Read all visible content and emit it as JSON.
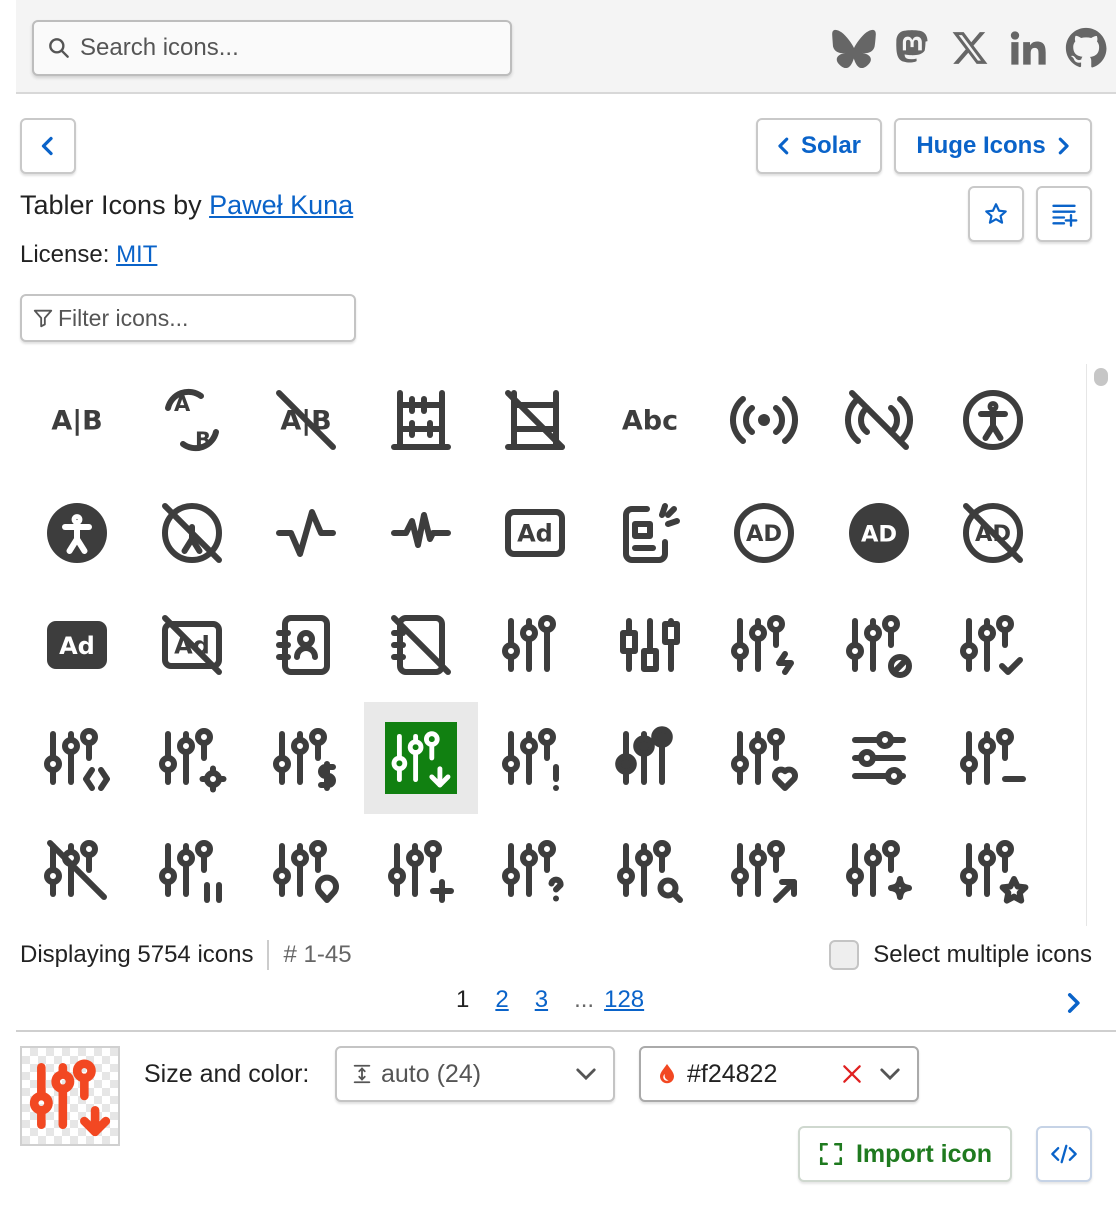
{
  "search": {
    "placeholder": "Search icons..."
  },
  "social": [
    "bluesky-icon",
    "mastodon-icon",
    "x-icon",
    "linkedin-icon",
    "github-icon"
  ],
  "nav": {
    "prev_set": "Solar",
    "next_set": "Huge Icons"
  },
  "iconset": {
    "title_prefix": "Tabler Icons by ",
    "author": "Paweł Kuna",
    "license_label": "License: ",
    "license": "MIT"
  },
  "filter": {
    "placeholder": "Filter icons..."
  },
  "icons": [
    "a-b",
    "a-b-2",
    "a-b-off",
    "abacus",
    "abacus-off",
    "abc",
    "access-point",
    "access-point-off",
    "accessible",
    "accessible-filled",
    "accessible-off",
    "activity",
    "activity-heartbeat",
    "ad",
    "ad-2",
    "ad-circle",
    "ad-circle-filled",
    "ad-circle-off",
    "ad-filled",
    "ad-off",
    "address-book",
    "address-book-off",
    "adjustments",
    "adjustments-alt",
    "adjustments-bolt",
    "adjustments-cancel",
    "adjustments-check",
    "adjustments-code",
    "adjustments-cog",
    "adjustments-dollar",
    "adjustments-down",
    "adjustments-exclamation",
    "adjustments-filled",
    "adjustments-heart",
    "adjustments-horizontal",
    "adjustments-minus",
    "adjustments-off",
    "adjustments-pause",
    "adjustments-pin",
    "adjustments-plus",
    "adjustments-question",
    "adjustments-search",
    "adjustments-share",
    "adjustments-spark",
    "adjustments-star"
  ],
  "selected_icon": "adjustments-down",
  "status": {
    "displaying": "Displaying 5754 icons",
    "range": "# 1-45",
    "select_multiple": "Select multiple icons"
  },
  "pagination": {
    "current": "1",
    "pages": [
      "2",
      "3"
    ],
    "ellipsis": "...",
    "last": "128"
  },
  "footer": {
    "size_color_label": "Size and color:",
    "size_value": "auto (24)",
    "color_value": "#f24822",
    "import_label": "Import icon"
  },
  "colors": {
    "accent": "#0a63c9",
    "selected_bg": "#118011",
    "icon": "#3d3d3d",
    "preview": "#f24822"
  }
}
